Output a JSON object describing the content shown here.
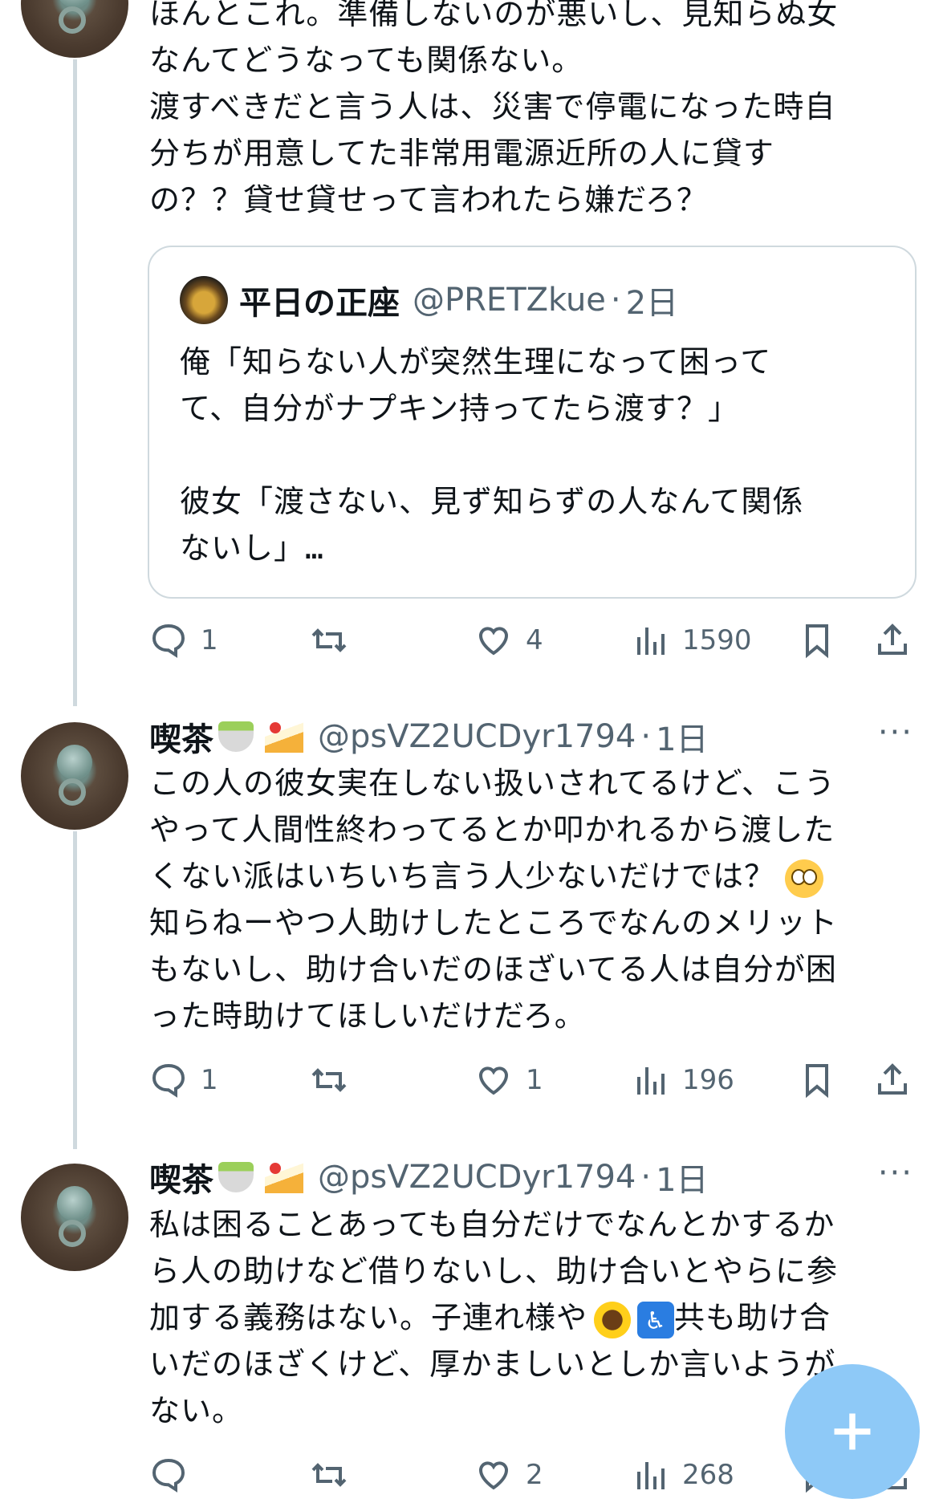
{
  "tweets": [
    {
      "text_lines": [
        "ほんとこれ。準備しないのが悪いし、見知らぬ女",
        "なんてどうなっても関係ない。",
        "渡すべきだと言う人は、災害で停電になった時自",
        "分ちが用意してた非常用電源近所の人に貸す",
        "の？？貸せ貸せって言われたら嫌だろ？"
      ],
      "quote": {
        "name": "平日の正座",
        "handle": "@PRETZkue",
        "time": "2日",
        "text_lines": [
          "俺「知らない人が突然生理になって困って",
          "て、自分がナプキン持ってたら渡す？」",
          "",
          "彼女「渡さない、見ず知らずの人なんて関係",
          "ないし」…"
        ]
      },
      "actions": {
        "replies": "1",
        "retweets": "",
        "likes": "4",
        "views": "1590"
      }
    },
    {
      "name": "喫茶",
      "handle": "@psVZ2UCDyr1794",
      "time": "1日",
      "more": "···",
      "text_lines": [
        "この人の彼女実在しない扱いされてるけど、こう",
        "やって人間性終わってるとか叩かれるから渡した",
        "くない派はいちいち言う人少ないだけでは？",
        "知らねーやつ人助けしたところでなんのメリット",
        "もないし、助け合いだのほざいてる人は自分が困",
        "った時助けてほしいだけだろ。"
      ],
      "actions": {
        "replies": "1",
        "retweets": "",
        "likes": "1",
        "views": "196"
      }
    },
    {
      "name": "喫茶",
      "handle": "@psVZ2UCDyr1794",
      "time": "1日",
      "more": "···",
      "text_lines": [
        "私は困ることあっても自分だけでなんとかするか",
        "ら人の助けなど借りないし、助け合いとやらに参",
        "加する義務はない。子連れ様や",
        "共も助け合",
        "いだのほざくけど、厚かましいとしか言いようが",
        "ない。"
      ],
      "actions": {
        "replies": "",
        "retweets": "",
        "likes": "2",
        "views": "268"
      }
    }
  ],
  "separator": "·",
  "icons": {
    "reply": "reply-icon",
    "retweet": "retweet-icon",
    "like": "heart-icon",
    "views": "views-icon",
    "bookmark": "bookmark-icon",
    "share": "share-icon",
    "compose": "plus-icon"
  },
  "colors": {
    "text": "#0f1419",
    "muted": "#536471",
    "fab": "#8ec9f7",
    "border": "#cfd9de"
  }
}
